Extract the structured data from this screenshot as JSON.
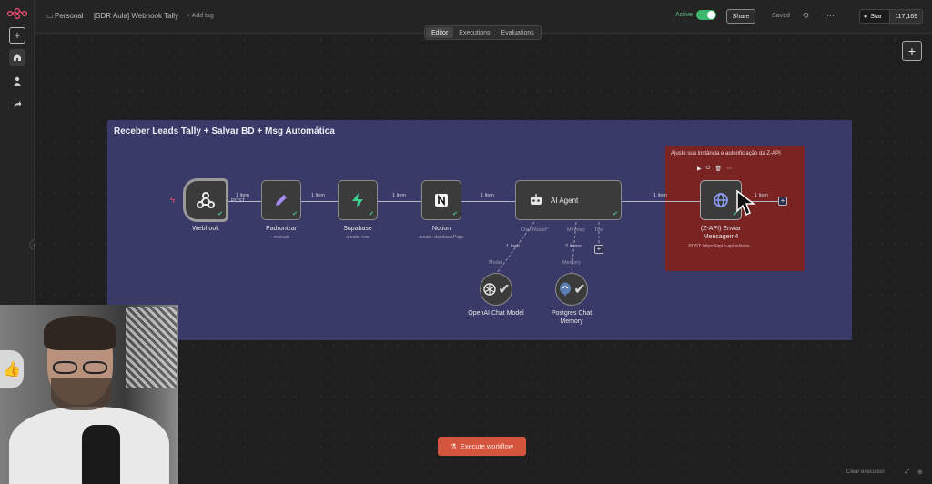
{
  "header": {
    "workspace": "Personal",
    "workflow_name": "[SDR Aula] Webhook Tally",
    "add_tag": "+ Add tag",
    "active_label": "Active",
    "share_label": "Share",
    "saved_label": "Saved",
    "star_label": "Star",
    "star_count": "117,169"
  },
  "view_tabs": [
    "Editor",
    "Executions",
    "Evaluations"
  ],
  "canvas": {
    "sticky_title": "Receber Leads Tally + Salvar BD + Msg Automática",
    "sticky_red_title": "Ajuste sua instância e autenficiação da Z-API",
    "nodes": {
      "webhook": {
        "label": "Webhook"
      },
      "padronizar": {
        "label": "Padronizar",
        "sub": "manual"
      },
      "supabase": {
        "label": "Supabase",
        "sub": "create: row"
      },
      "notion": {
        "label": "Notion",
        "sub": "create: databasePage"
      },
      "ai_agent": {
        "label": "AI Agent"
      },
      "zapi": {
        "label_line1": "(Z-API) Enviar",
        "label_line2": "Mensagem4",
        "sub": "POST: https://api.z-api.io/insta..."
      },
      "openai": {
        "label": "OpenAI Chat Model"
      },
      "postgres": {
        "label_line1": "Postgres Chat",
        "label_line2": "Memory"
      }
    },
    "connections": {
      "c1": "1 item",
      "c1_method": "POST",
      "c2": "1 item",
      "c3": "1 item",
      "c4": "1 item",
      "c5": "1 item",
      "c6": "1 item",
      "c_model": "1 item",
      "c_memory": "2 items"
    },
    "ports": {
      "chat_model": "Chat Model*",
      "memory": "Memory",
      "tool": "Tool",
      "model_small": "Model",
      "memory_small": "Memory"
    },
    "execute_label": "Execute workflow",
    "clear_execution": "Clear execution"
  },
  "colors": {
    "accent": "#ea4b71",
    "active_green": "#3db86f",
    "sticky_purple": "#3a3a68",
    "sticky_red": "#7a2323",
    "execute_button": "#d5543d"
  }
}
